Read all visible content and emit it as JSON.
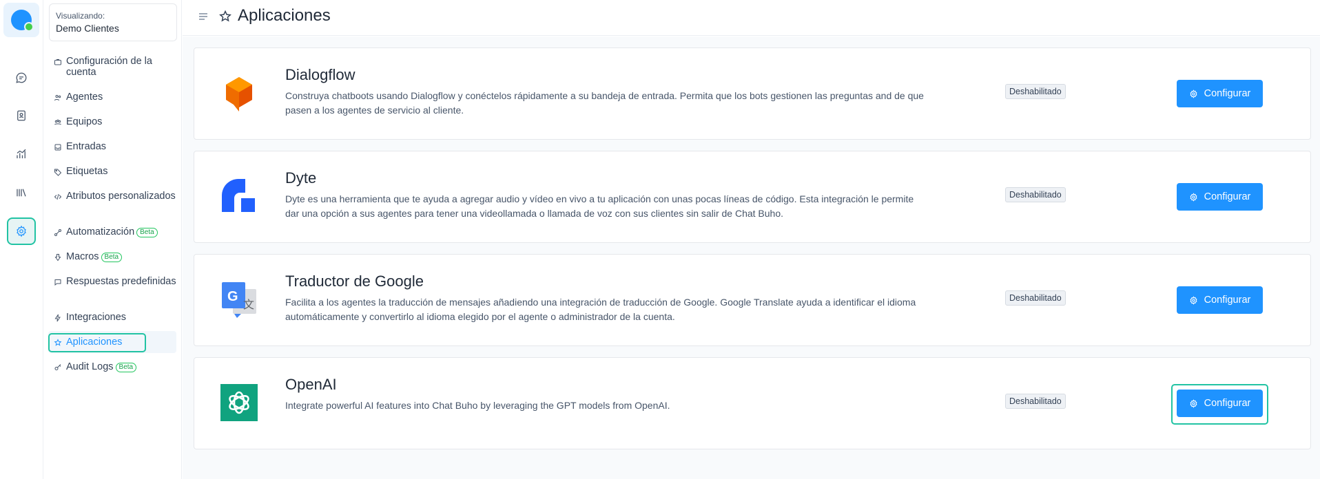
{
  "account": {
    "label": "Visualizando:",
    "name": "Demo Clientes"
  },
  "sidebar": {
    "items": [
      {
        "label": "Configuración de la cuenta",
        "icon": "briefcase-icon"
      },
      {
        "label": "Agentes",
        "icon": "people-icon"
      },
      {
        "label": "Equipos",
        "icon": "team-icon"
      },
      {
        "label": "Entradas",
        "icon": "inbox-icon"
      },
      {
        "label": "Etiquetas",
        "icon": "tag-icon"
      },
      {
        "label": "Atributos personalizados",
        "icon": "code-icon"
      },
      {
        "label": "Automatización",
        "icon": "automation-icon",
        "badge": "Beta"
      },
      {
        "label": "Macros",
        "icon": "macro-icon",
        "badge": "Beta"
      },
      {
        "label": "Respuestas predefinidas",
        "icon": "chat-bubble-icon"
      },
      {
        "label": "Integraciones",
        "icon": "flash-icon"
      },
      {
        "label": "Aplicaciones",
        "icon": "star-icon"
      },
      {
        "label": "Audit Logs",
        "icon": "key-icon",
        "badge": "Beta"
      }
    ]
  },
  "header": {
    "title": "Aplicaciones"
  },
  "apps": [
    {
      "name": "Dialogflow",
      "description": "Construya chatboots usando Dialogflow y conéctelos rápidamente a su bandeja de entrada. Permita que los bots gestionen las preguntas and de que pasen a los agentes de servicio al cliente.",
      "status": "Deshabilitado",
      "button": "Configurar"
    },
    {
      "name": "Dyte",
      "description": "Dyte es una herramienta que te ayuda a agregar audio y vídeo en vivo a tu aplicación con unas pocas líneas de código. Esta integración le permite dar una opción a sus agentes para tener una videollamada o llamada de voz con sus clientes sin salir de Chat Buho.",
      "status": "Deshabilitado",
      "button": "Configurar"
    },
    {
      "name": "Traductor de Google",
      "description": "Facilita a los agentes la traducción de mensajes añadiendo una integración de traducción de Google. Google Translate ayuda a identificar el idioma automáticamente y convertirlo al idioma elegido por el agente o administrador de la cuenta.",
      "status": "Deshabilitado",
      "button": "Configurar"
    },
    {
      "name": "OpenAI",
      "description": "Integrate powerful AI features into Chat Buho by leveraging the GPT models from OpenAI.",
      "status": "Deshabilitado",
      "button": "Configurar"
    }
  ],
  "colors": {
    "accent": "#1f93ff",
    "focus": "#21c3a3",
    "badge_bg": "#eef1f5",
    "background": "#f8fafc"
  }
}
